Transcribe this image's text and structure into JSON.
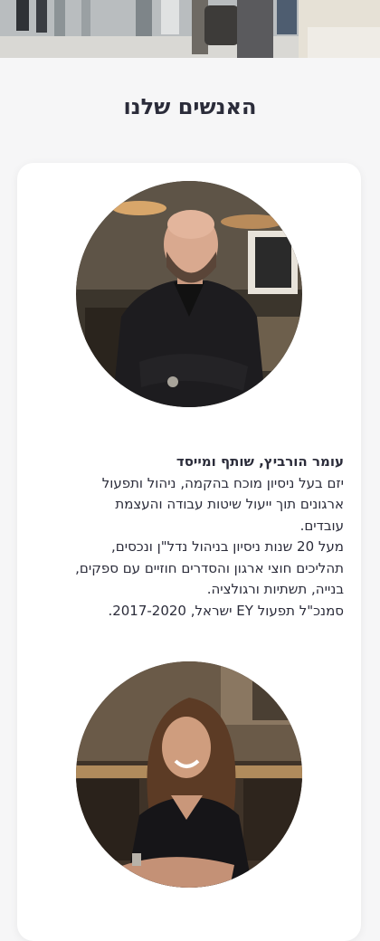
{
  "section": {
    "title": "האנשים שלנו"
  },
  "people": [
    {
      "name_title": "עומר הורביץ, שותף ומייסד",
      "bio_lines": [
        "יזם בעל ניסיון מוכח בהקמה, ניהול ותפעול",
        "ארגונים תוך ייעול שיטות עבודה והעצמת",
        "עובדים.",
        "מעל 20 שנות ניסיון בניהול נדל\"ן ונכסים,",
        "תהליכים חוצי ארגון והסדרים חוזיים עם ספקים,",
        "בנייה, תשתיות ורגולציה.",
        "סמנכ\"ל תפעול EY ישראל, 2017-2020."
      ]
    }
  ],
  "colors": {
    "text": "#2b2c3a",
    "page_bg": "#f6f6f7",
    "card_bg": "#ffffff"
  }
}
